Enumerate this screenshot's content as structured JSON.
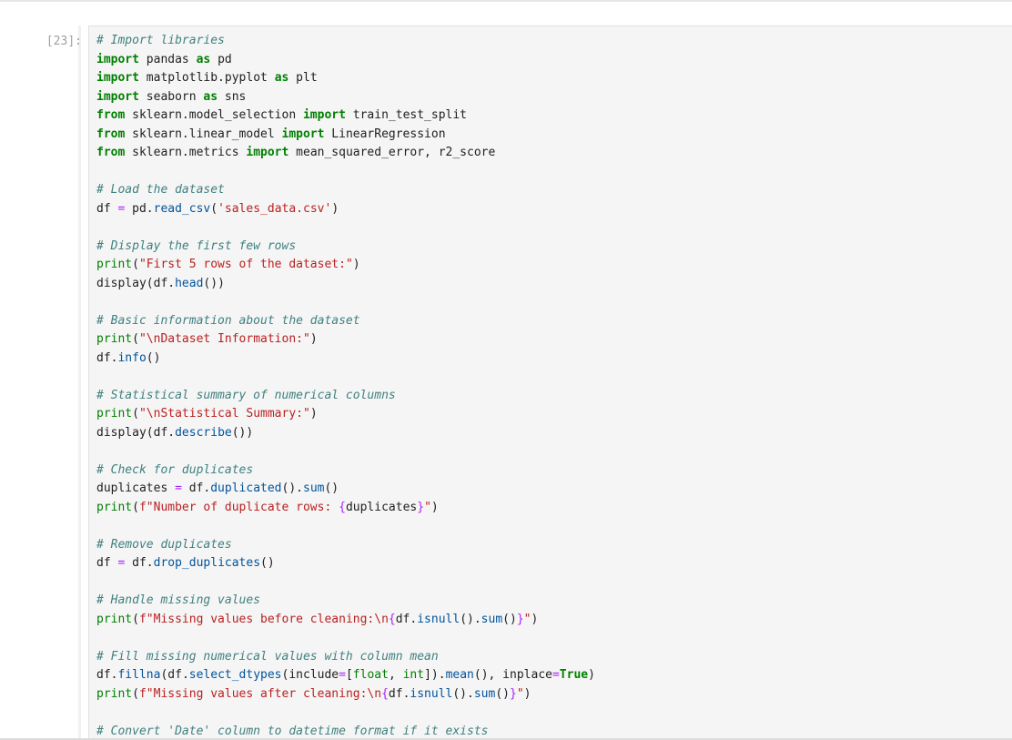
{
  "cell": {
    "prompt": "[23]:",
    "lines": [
      [
        {
          "t": "# Import libraries",
          "c": "cm"
        }
      ],
      [
        {
          "t": "import",
          "c": "kw"
        },
        {
          "t": " pandas ",
          "c": ""
        },
        {
          "t": "as",
          "c": "kw"
        },
        {
          "t": " pd",
          "c": ""
        }
      ],
      [
        {
          "t": "import",
          "c": "kw"
        },
        {
          "t": " matplotlib.pyplot ",
          "c": ""
        },
        {
          "t": "as",
          "c": "kw"
        },
        {
          "t": " plt",
          "c": ""
        }
      ],
      [
        {
          "t": "import",
          "c": "kw"
        },
        {
          "t": " seaborn ",
          "c": ""
        },
        {
          "t": "as",
          "c": "kw"
        },
        {
          "t": " sns",
          "c": ""
        }
      ],
      [
        {
          "t": "from",
          "c": "kw"
        },
        {
          "t": " sklearn.model_selection ",
          "c": ""
        },
        {
          "t": "import",
          "c": "kw"
        },
        {
          "t": " train_test_split",
          "c": ""
        }
      ],
      [
        {
          "t": "from",
          "c": "kw"
        },
        {
          "t": " sklearn.linear_model ",
          "c": ""
        },
        {
          "t": "import",
          "c": "kw"
        },
        {
          "t": " LinearRegression",
          "c": ""
        }
      ],
      [
        {
          "t": "from",
          "c": "kw"
        },
        {
          "t": " sklearn.metrics ",
          "c": ""
        },
        {
          "t": "import",
          "c": "kw"
        },
        {
          "t": " mean_squared_error, r2_score",
          "c": ""
        }
      ],
      [],
      [
        {
          "t": "# Load the dataset",
          "c": "cm"
        }
      ],
      [
        {
          "t": "df ",
          "c": ""
        },
        {
          "t": "=",
          "c": "op"
        },
        {
          "t": " pd",
          "c": ""
        },
        {
          "t": ".",
          "c": ""
        },
        {
          "t": "read_csv",
          "c": "fn"
        },
        {
          "t": "(",
          "c": ""
        },
        {
          "t": "'sales_data.csv'",
          "c": "st"
        },
        {
          "t": ")",
          "c": ""
        }
      ],
      [],
      [
        {
          "t": "# Display the first few rows",
          "c": "cm"
        }
      ],
      [
        {
          "t": "print",
          "c": "bi"
        },
        {
          "t": "(",
          "c": ""
        },
        {
          "t": "\"First 5 rows of the dataset:\"",
          "c": "st"
        },
        {
          "t": ")",
          "c": ""
        }
      ],
      [
        {
          "t": "display(df",
          "c": ""
        },
        {
          "t": ".",
          "c": ""
        },
        {
          "t": "head",
          "c": "fn"
        },
        {
          "t": "())",
          "c": ""
        }
      ],
      [],
      [
        {
          "t": "# Basic information about the dataset",
          "c": "cm"
        }
      ],
      [
        {
          "t": "print",
          "c": "bi"
        },
        {
          "t": "(",
          "c": ""
        },
        {
          "t": "\"\\nDataset Information:\"",
          "c": "st"
        },
        {
          "t": ")",
          "c": ""
        }
      ],
      [
        {
          "t": "df",
          "c": ""
        },
        {
          "t": ".",
          "c": ""
        },
        {
          "t": "info",
          "c": "fn"
        },
        {
          "t": "()",
          "c": ""
        }
      ],
      [],
      [
        {
          "t": "# Statistical summary of numerical columns",
          "c": "cm"
        }
      ],
      [
        {
          "t": "print",
          "c": "bi"
        },
        {
          "t": "(",
          "c": ""
        },
        {
          "t": "\"\\nStatistical Summary:\"",
          "c": "st"
        },
        {
          "t": ")",
          "c": ""
        }
      ],
      [
        {
          "t": "display(df",
          "c": ""
        },
        {
          "t": ".",
          "c": ""
        },
        {
          "t": "describe",
          "c": "fn"
        },
        {
          "t": "())",
          "c": ""
        }
      ],
      [],
      [
        {
          "t": "# Check for duplicates",
          "c": "cm"
        }
      ],
      [
        {
          "t": "duplicates ",
          "c": ""
        },
        {
          "t": "=",
          "c": "op"
        },
        {
          "t": " df",
          "c": ""
        },
        {
          "t": ".",
          "c": ""
        },
        {
          "t": "duplicated",
          "c": "fn"
        },
        {
          "t": "()",
          "c": ""
        },
        {
          "t": ".",
          "c": ""
        },
        {
          "t": "sum",
          "c": "fn"
        },
        {
          "t": "()",
          "c": ""
        }
      ],
      [
        {
          "t": "print",
          "c": "bi"
        },
        {
          "t": "(",
          "c": ""
        },
        {
          "t": "f\"Number of duplicate rows: ",
          "c": "st"
        },
        {
          "t": "{",
          "c": "op"
        },
        {
          "t": "duplicates",
          "c": ""
        },
        {
          "t": "}",
          "c": "op"
        },
        {
          "t": "\"",
          "c": "st"
        },
        {
          "t": ")",
          "c": ""
        }
      ],
      [],
      [
        {
          "t": "# Remove duplicates",
          "c": "cm"
        }
      ],
      [
        {
          "t": "df ",
          "c": ""
        },
        {
          "t": "=",
          "c": "op"
        },
        {
          "t": " df",
          "c": ""
        },
        {
          "t": ".",
          "c": ""
        },
        {
          "t": "drop_duplicates",
          "c": "fn"
        },
        {
          "t": "()",
          "c": ""
        }
      ],
      [],
      [
        {
          "t": "# Handle missing values",
          "c": "cm"
        }
      ],
      [
        {
          "t": "print",
          "c": "bi"
        },
        {
          "t": "(",
          "c": ""
        },
        {
          "t": "f\"Missing values before cleaning:\\n",
          "c": "st"
        },
        {
          "t": "{",
          "c": "op"
        },
        {
          "t": "df",
          "c": ""
        },
        {
          "t": ".",
          "c": ""
        },
        {
          "t": "isnull",
          "c": "fn"
        },
        {
          "t": "()",
          "c": ""
        },
        {
          "t": ".",
          "c": ""
        },
        {
          "t": "sum",
          "c": "fn"
        },
        {
          "t": "()",
          "c": ""
        },
        {
          "t": "}",
          "c": "op"
        },
        {
          "t": "\"",
          "c": "st"
        },
        {
          "t": ")",
          "c": ""
        }
      ],
      [],
      [
        {
          "t": "# Fill missing numerical values with column mean",
          "c": "cm"
        }
      ],
      [
        {
          "t": "df",
          "c": ""
        },
        {
          "t": ".",
          "c": ""
        },
        {
          "t": "fillna",
          "c": "fn"
        },
        {
          "t": "(df",
          "c": ""
        },
        {
          "t": ".",
          "c": ""
        },
        {
          "t": "select_dtypes",
          "c": "fn"
        },
        {
          "t": "(include",
          "c": ""
        },
        {
          "t": "=",
          "c": "op"
        },
        {
          "t": "[",
          "c": ""
        },
        {
          "t": "float",
          "c": "bi"
        },
        {
          "t": ", ",
          "c": ""
        },
        {
          "t": "int",
          "c": "bi"
        },
        {
          "t": "])",
          "c": ""
        },
        {
          "t": ".",
          "c": ""
        },
        {
          "t": "mean",
          "c": "fn"
        },
        {
          "t": "(), inplace",
          "c": ""
        },
        {
          "t": "=",
          "c": "op"
        },
        {
          "t": "True",
          "c": "kw"
        },
        {
          "t": ")",
          "c": ""
        }
      ],
      [
        {
          "t": "print",
          "c": "bi"
        },
        {
          "t": "(",
          "c": ""
        },
        {
          "t": "f\"Missing values after cleaning:\\n",
          "c": "st"
        },
        {
          "t": "{",
          "c": "op"
        },
        {
          "t": "df",
          "c": ""
        },
        {
          "t": ".",
          "c": ""
        },
        {
          "t": "isnull",
          "c": "fn"
        },
        {
          "t": "()",
          "c": ""
        },
        {
          "t": ".",
          "c": ""
        },
        {
          "t": "sum",
          "c": "fn"
        },
        {
          "t": "()",
          "c": ""
        },
        {
          "t": "}",
          "c": "op"
        },
        {
          "t": "\"",
          "c": "st"
        },
        {
          "t": ")",
          "c": ""
        }
      ],
      [],
      [
        {
          "t": "# Convert 'Date' column to datetime format if it exists",
          "c": "cm"
        }
      ]
    ]
  },
  "colors": {
    "comment": "#408080",
    "keyword": "#008000",
    "string": "#ba2121",
    "function": "#00539c",
    "operator": "#aa22ff",
    "editor_bg": "#f5f5f5",
    "prompt": "#a0a0a0"
  }
}
